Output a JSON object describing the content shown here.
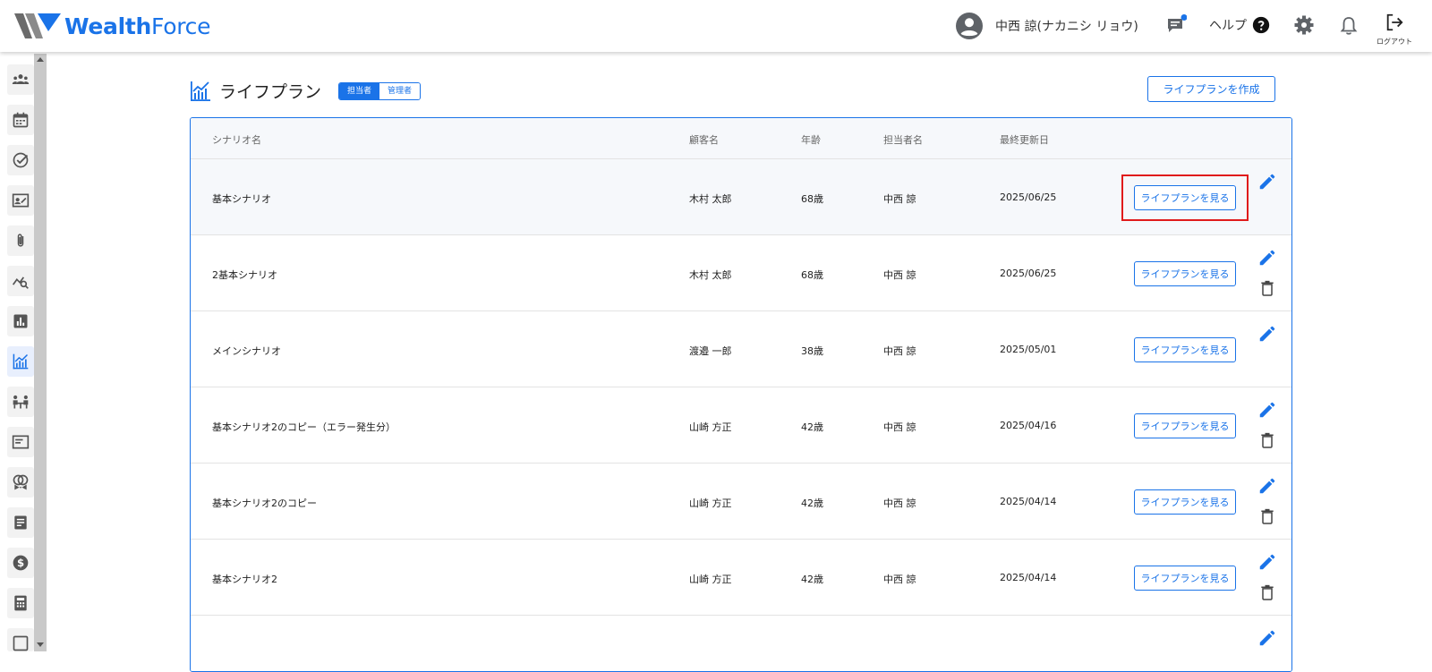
{
  "brand": {
    "logo_strong": "Wealth",
    "logo_light": "Force",
    "accent": "#1a73e8"
  },
  "header": {
    "user_name": "中西 諒(ナカニシ リョウ)",
    "help_label": "ヘルプ",
    "logout_label": "ログアウト",
    "icons": [
      "account-circle-icon",
      "chat-icon",
      "help-icon",
      "gear-icon",
      "bell-icon",
      "logout-icon"
    ]
  },
  "sidebar": {
    "icons": [
      "customers-icon",
      "calendar-icon",
      "task-check-icon",
      "contact-card-icon",
      "attachment-icon",
      "analysis-icon",
      "report-icon",
      "life-plan-icon",
      "meeting-icon",
      "document-icon",
      "insurance-icon",
      "notes-icon",
      "dollar-icon",
      "calculator-icon",
      "more-icon"
    ],
    "active_index": 7
  },
  "page": {
    "title": "ライフプラン",
    "toggle": {
      "on_label": "担当者",
      "off_label": "管理者"
    },
    "create_button": "ライフプランを作成"
  },
  "table": {
    "columns": {
      "scenario": "シナリオ名",
      "customer": "顧客名",
      "age": "年齢",
      "staff": "担当者名",
      "updated": "最終更新日"
    },
    "view_button_label": "ライフプランを見る",
    "rows": [
      {
        "scenario": "基本シナリオ",
        "customer": "木村 太郎",
        "age": "68歳",
        "staff": "中西 諒",
        "updated": "2025/06/25",
        "deletable": false,
        "highlighted": true
      },
      {
        "scenario": "2基本シナリオ",
        "customer": "木村 太郎",
        "age": "68歳",
        "staff": "中西 諒",
        "updated": "2025/06/25",
        "deletable": true,
        "highlighted": false
      },
      {
        "scenario": "メインシナリオ",
        "customer": "渡邉 一郎",
        "age": "38歳",
        "staff": "中西 諒",
        "updated": "2025/05/01",
        "deletable": false,
        "highlighted": false
      },
      {
        "scenario": "基本シナリオ2のコピー（エラー発生分）",
        "customer": "山崎 方正",
        "age": "42歳",
        "staff": "中西 諒",
        "updated": "2025/04/16",
        "deletable": true,
        "highlighted": false
      },
      {
        "scenario": "基本シナリオ2のコピー",
        "customer": "山崎 方正",
        "age": "42歳",
        "staff": "中西 諒",
        "updated": "2025/04/14",
        "deletable": true,
        "highlighted": false
      },
      {
        "scenario": "基本シナリオ2",
        "customer": "山崎 方正",
        "age": "42歳",
        "staff": "中西 諒",
        "updated": "2025/04/14",
        "deletable": true,
        "highlighted": false
      }
    ]
  }
}
